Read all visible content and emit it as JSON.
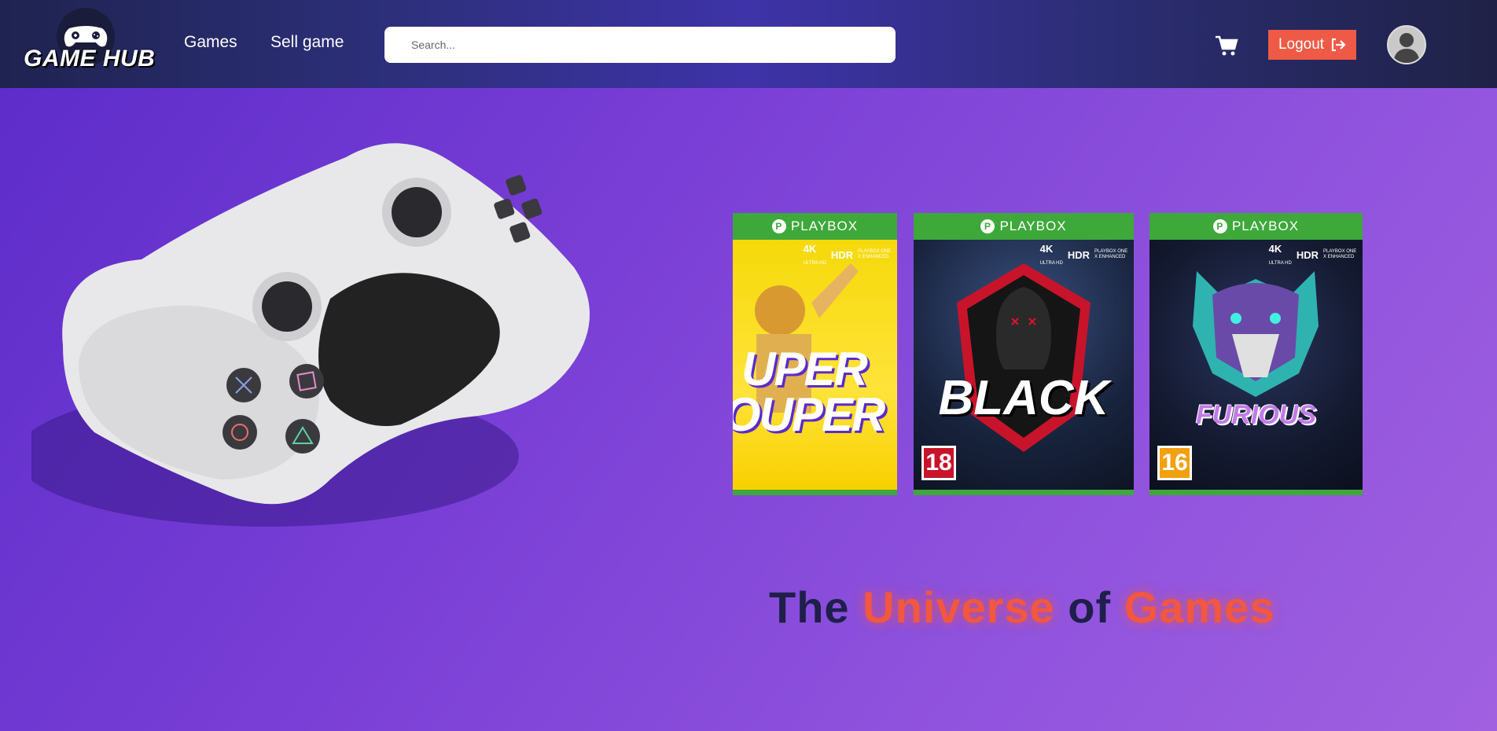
{
  "header": {
    "logo_text": "GAME HUB",
    "nav": {
      "games": "Games",
      "sell_game": "Sell game"
    },
    "search": {
      "placeholder": "Search..."
    },
    "logout_label": "Logout"
  },
  "covers": [
    {
      "platform": "PLAYBOX",
      "badge_4k": "4K",
      "badge_4k_sub": "ULTRA HD",
      "badge_hdr": "HDR",
      "badge_enh": "PLAYBOX ONE X ENHANCED",
      "title": "UPER OUPER"
    },
    {
      "platform": "PLAYBOX",
      "badge_4k": "4K",
      "badge_4k_sub": "ULTRA HD",
      "badge_hdr": "HDR",
      "badge_enh": "PLAYBOX ONE X ENHANCED",
      "title": "BLACK",
      "rating": "18"
    },
    {
      "platform": "PLAYBOX",
      "badge_4k": "4K",
      "badge_4k_sub": "ULTRA HD",
      "badge_hdr": "HDR",
      "badge_enh": "PLAYBOX ONE X ENHANCED",
      "title": "FURIOUS",
      "rating": "16"
    }
  ],
  "tagline": {
    "w1": "The",
    "w2": "Universe",
    "w3": "of",
    "w4": "Games"
  },
  "colors": {
    "accent": "#ee5a46",
    "cover_green": "#3ea83a",
    "bg_purple": "#7a3fd6"
  },
  "icons": {
    "cart": "cart-icon",
    "logout": "logout-icon",
    "avatar": "user-avatar-icon"
  }
}
